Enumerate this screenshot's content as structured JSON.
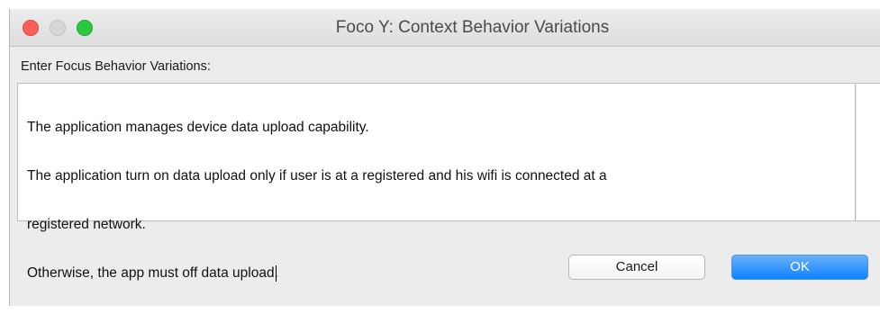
{
  "window": {
    "title": "Foco Y: Context Behavior Variations"
  },
  "dialog": {
    "prompt_label": "Enter Focus Behavior Variations:",
    "text_lines": [
      "The application manages device data upload capability.",
      "The application turn on data upload only if user is at a registered and his wifi is connected at a",
      "registered network.",
      "Otherwise, the app must off data upload."
    ]
  },
  "buttons": {
    "cancel_label": "Cancel",
    "ok_label": "OK"
  },
  "colors": {
    "close": "#fc5f57",
    "minimize": "#d7d7d7",
    "zoom": "#2bc840",
    "primary_button": "#1a8cff"
  }
}
